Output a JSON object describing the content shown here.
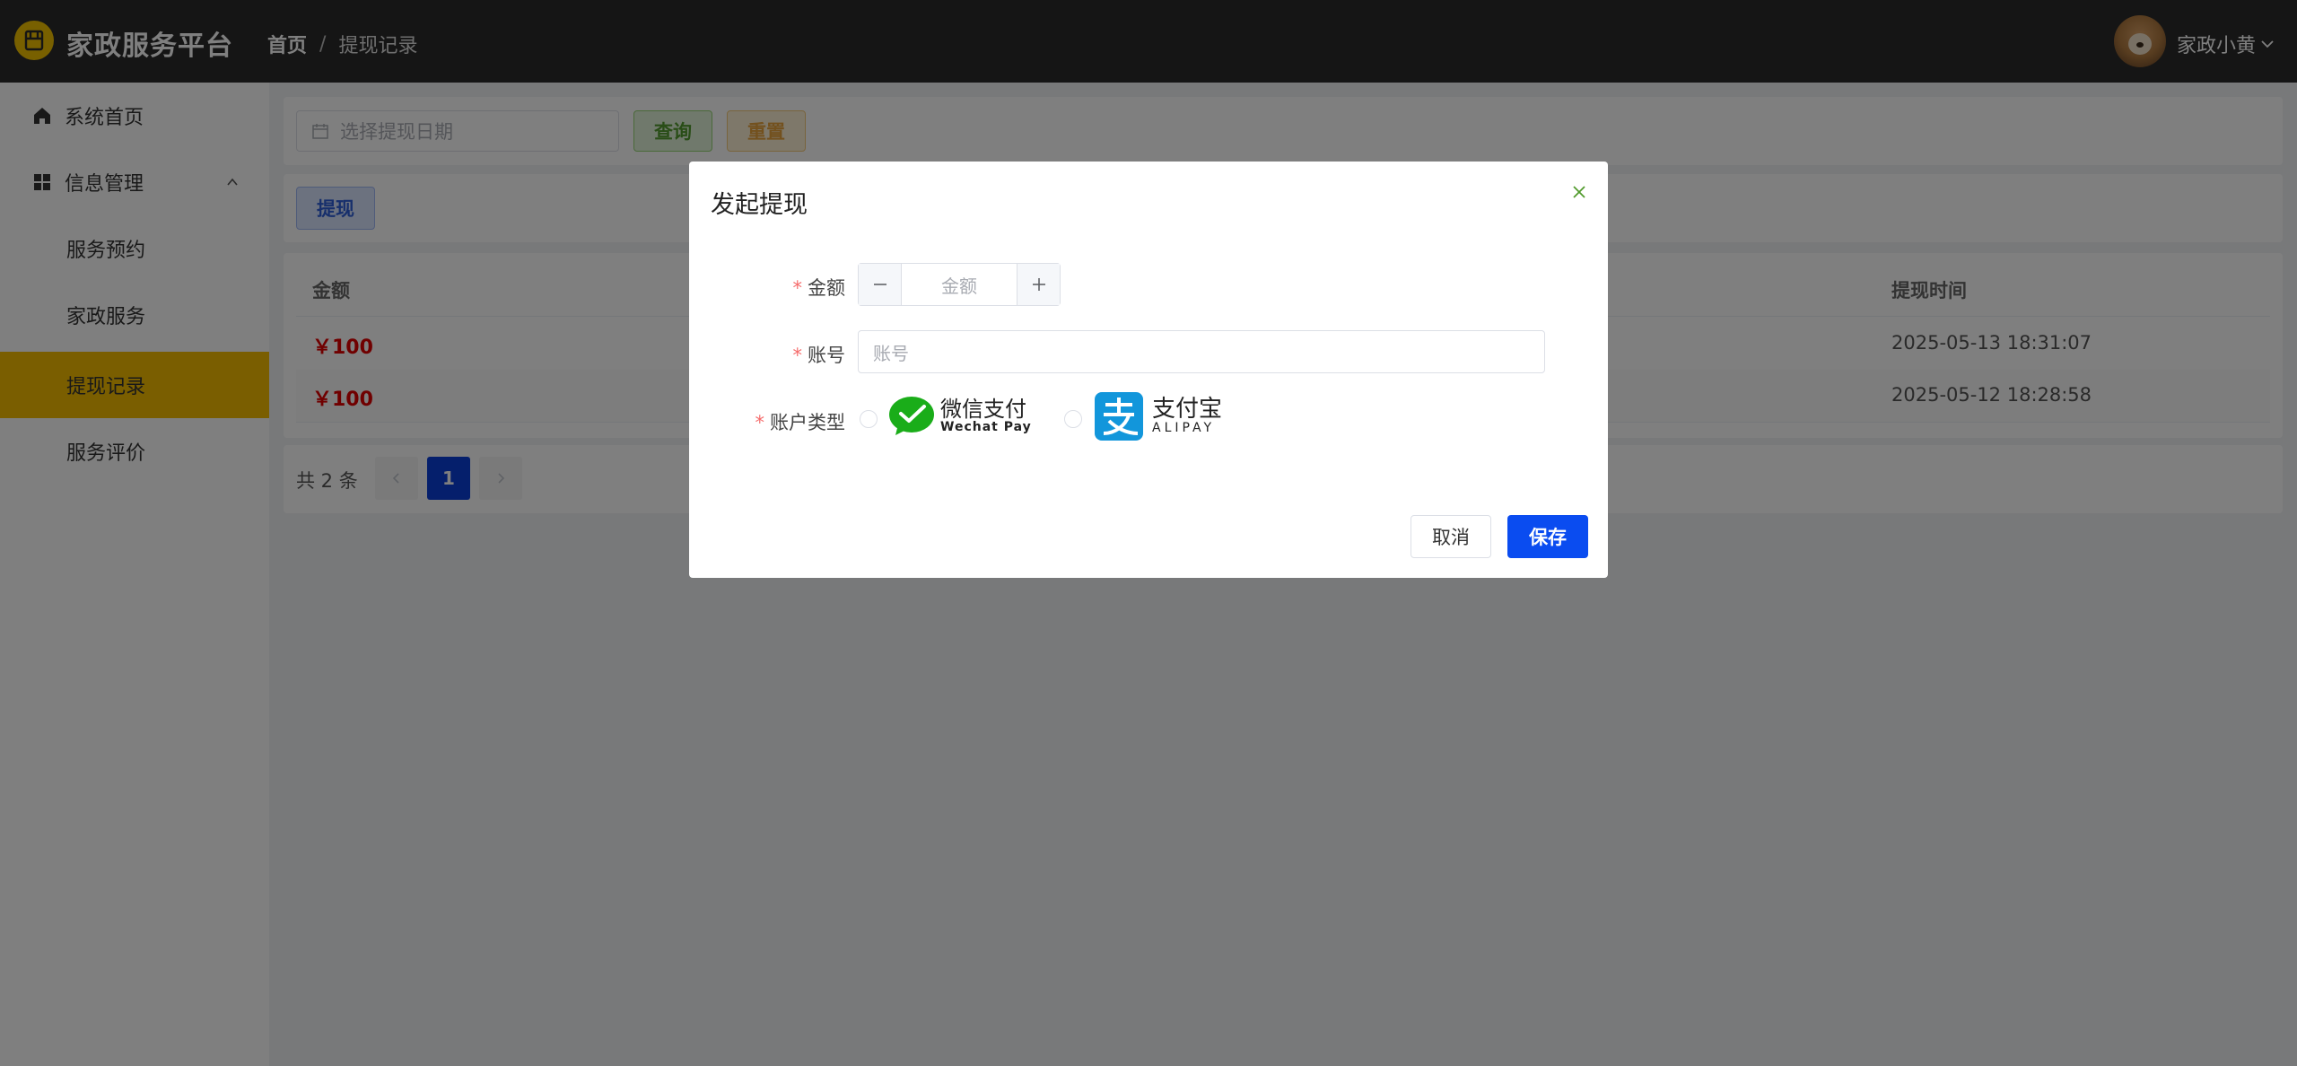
{
  "header": {
    "app_title": "家政服务平台",
    "breadcrumb": {
      "home": "首页",
      "separator": "/",
      "current": "提现记录"
    },
    "user_name": "家政小黄"
  },
  "sidebar": {
    "items": [
      {
        "label": "系统首页",
        "icon": "home-icon"
      },
      {
        "label": "信息管理",
        "icon": "grid-icon",
        "expanded": true
      },
      {
        "label": "服务预约"
      },
      {
        "label": "家政服务"
      },
      {
        "label": "提现记录",
        "active": true
      },
      {
        "label": "服务评价"
      }
    ]
  },
  "search": {
    "date_placeholder": "选择提现日期",
    "query_label": "查询",
    "reset_label": "重置"
  },
  "toolbar": {
    "withdraw_label": "提现"
  },
  "table": {
    "columns": {
      "amount": "金额",
      "time": "提现时间"
    },
    "rows": [
      {
        "amount": "￥100",
        "time": "2025-05-13 18:31:07"
      },
      {
        "amount": "￥100",
        "time": "2025-05-12 18:28:58"
      }
    ]
  },
  "pagination": {
    "total": "共 2 条",
    "current_page": "1"
  },
  "dialog": {
    "title": "发起提现",
    "amount_label": "金额",
    "amount_placeholder": "金额",
    "account_label": "账号",
    "account_placeholder": "账号",
    "account_type_label": "账户类型",
    "required_mark": "*",
    "wechat": {
      "cn": "微信支付",
      "en": "Wechat Pay"
    },
    "alipay": {
      "cn": "支付宝",
      "en": "ALIPAY"
    },
    "cancel_label": "取消",
    "save_label": "保存"
  },
  "colors": {
    "header_bg": "#2b2b2b",
    "active_menu": "#f5bd00",
    "primary": "#0a4cf0",
    "amount_red": "#e00000"
  }
}
